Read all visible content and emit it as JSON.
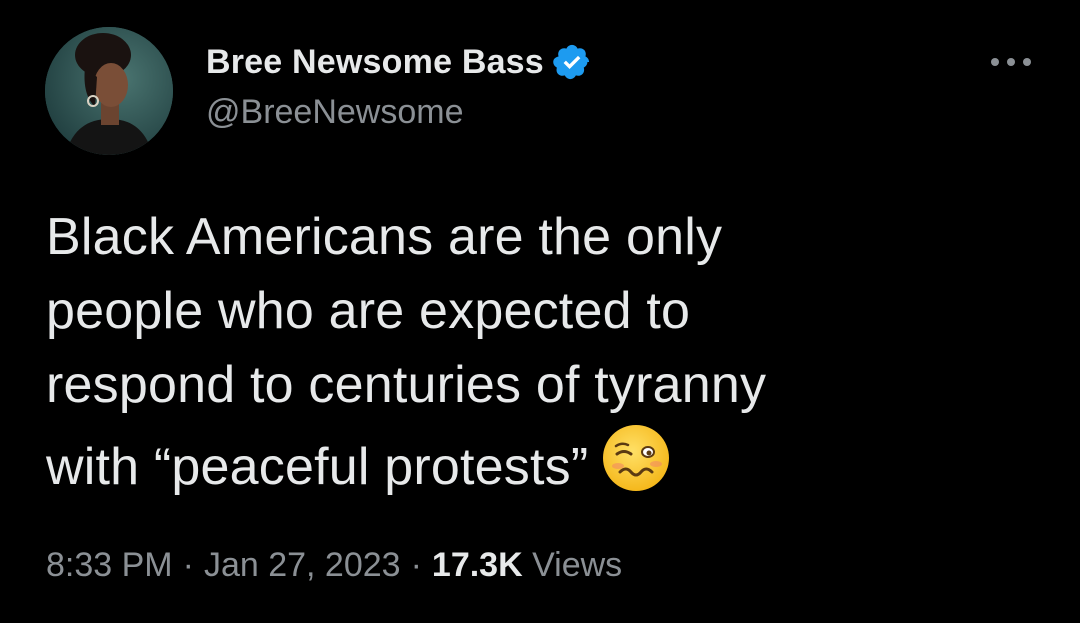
{
  "author": {
    "display_name": "Bree Newsome Bass",
    "handle": "@BreeNewsome",
    "verified": true,
    "verified_color": "#1d9bf0"
  },
  "tweet": {
    "lines": [
      "Black Americans are the only",
      "people who are expected to",
      "respond to centuries of tyranny",
      "with “peaceful protests”"
    ],
    "emoji": "woozy-face"
  },
  "meta": {
    "time": "8:33 PM",
    "separator": "·",
    "date": "Jan 27, 2023",
    "views_count": "17.3K",
    "views_label": "Views"
  },
  "icons": {
    "more": "more-options-icon",
    "verified": "verified-badge-icon"
  },
  "colors": {
    "background": "#000000",
    "primary_text": "#e7e9ea",
    "secondary_text": "#8b9095"
  }
}
